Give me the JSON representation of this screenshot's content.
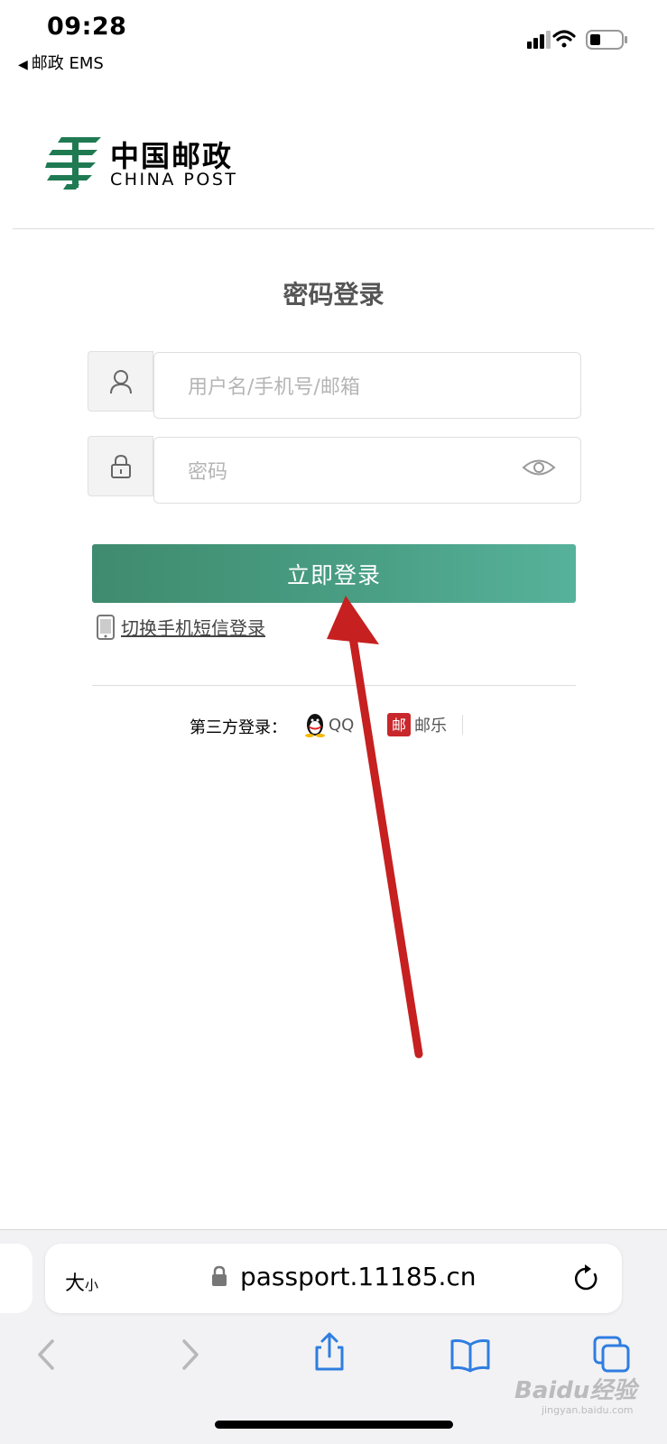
{
  "status_bar": {
    "time": "09:28",
    "back_app": "邮政 EMS"
  },
  "logo": {
    "cn": "中国邮政",
    "en": "CHINA POST"
  },
  "login": {
    "title": "密码登录",
    "username_placeholder": "用户名/手机号/邮箱",
    "password_placeholder": "密码",
    "submit_label": "立即登录",
    "sms_switch_label": "切换手机短信登录"
  },
  "third_party": {
    "label": "第三方登录：",
    "qq": "QQ",
    "youle": "邮乐"
  },
  "browser": {
    "text_size_big": "大",
    "text_size_small": "小",
    "url": "passport.11185.cn"
  },
  "watermark": {
    "main": "Baidu经验",
    "sub": "jingyan.baidu.com"
  },
  "colors": {
    "brand_green": "#2e8b57",
    "button_green": "#4aa085",
    "annotation_red": "#c62020",
    "ios_blue": "#2f7de1"
  },
  "icons": {
    "user": "user-icon",
    "lock": "lock-icon",
    "eye": "eye-icon",
    "phone": "phone-icon",
    "qq": "qq-penguin-icon",
    "youle": "youle-icon",
    "reload": "reload-icon",
    "share": "share-icon",
    "bookmarks": "book-icon",
    "tabs": "tabs-icon"
  }
}
